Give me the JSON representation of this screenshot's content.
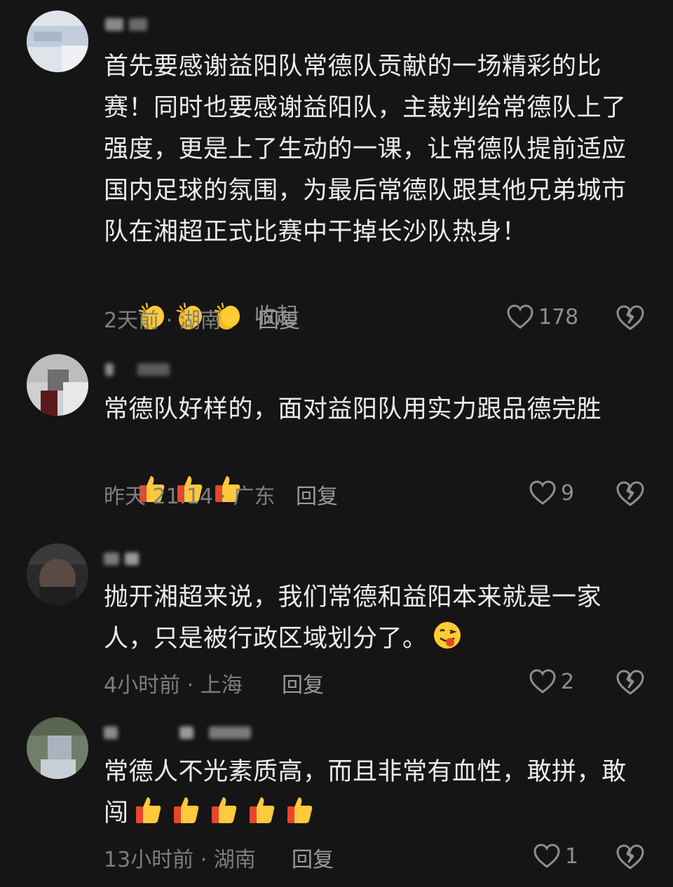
{
  "comments": [
    {
      "text": "首先要感谢益阳队常德队贡献的一场精彩的比赛！同时也要感谢益阳队，主裁判给常德队上了强度，更是上了生动的一课，让常德队提前适应国内足球的氛围，为最后常德队跟其他兄弟城市队在湘超正式比赛中干掉长沙队热身！",
      "emojis": [
        "clapping-hands",
        "clapping-hands",
        "clapping-hands"
      ],
      "collapse_label": "收起",
      "meta": "2天前 · 湖南",
      "reply_label": "回复",
      "likes": "178"
    },
    {
      "text": "常德队好样的，面对益阳队用实力跟品德完胜",
      "emojis": [
        "thumbs-up",
        "thumbs-up",
        "thumbs-up"
      ],
      "meta": "昨天 21:14 · 广东",
      "reply_label": "回复",
      "likes": "9"
    },
    {
      "text": "抛开湘超来说，我们常德和益阳本来就是一家人，只是被行政区域划分了。",
      "emojis": [
        "tongue-face"
      ],
      "meta": "4小时前 · 上海",
      "reply_label": "回复",
      "likes": "2"
    },
    {
      "text": "常德人不光素质高，而且非常有血性，敢拼，敢闯",
      "emojis": [
        "thumbs-up",
        "thumbs-up",
        "thumbs-up",
        "thumbs-up",
        "thumbs-up"
      ],
      "meta": "13小时前 · 湖南",
      "reply_label": "回复",
      "likes": "1"
    }
  ],
  "colors": {
    "background": "#151515",
    "text": "#ececec",
    "meta": "#7e7e7e",
    "icon": "#8f8f8f"
  },
  "icons": [
    "heart-outline-icon",
    "broken-heart-icon",
    "clapping-hands-emoji",
    "thumbs-up-emoji",
    "tongue-face-emoji"
  ]
}
